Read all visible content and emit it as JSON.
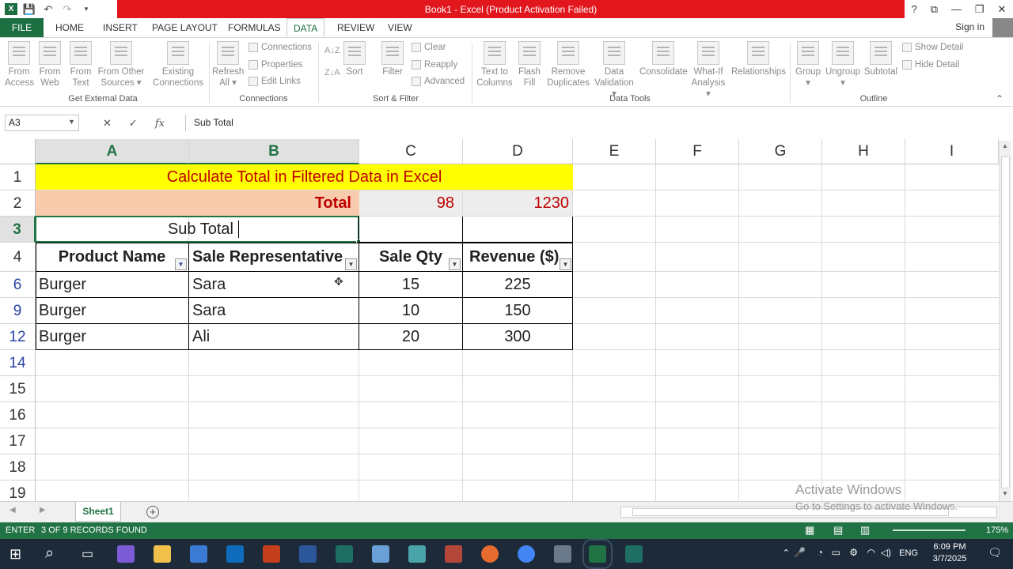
{
  "window": {
    "title": "Book1 - Excel (Product Activation Failed)",
    "buttons": [
      "?",
      "⧉",
      "—",
      "❐",
      "✕"
    ]
  },
  "tabs": [
    "FILE",
    "HOME",
    "INSERT",
    "PAGE LAYOUT",
    "FORMULAS",
    "DATA",
    "REVIEW",
    "VIEW"
  ],
  "active_tab": "DATA",
  "signin": "Sign in",
  "ribbon": {
    "get_external": {
      "buttons": [
        {
          "l1": "From",
          "l2": "Access"
        },
        {
          "l1": "From",
          "l2": "Web"
        },
        {
          "l1": "From",
          "l2": "Text"
        },
        {
          "l1": "From Other",
          "l2": "Sources ▾"
        },
        {
          "l1": "Existing",
          "l2": "Connections"
        }
      ],
      "label": "Get External Data"
    },
    "connections": {
      "refresh_l1": "Refresh",
      "refresh_l2": "All ▾",
      "small": [
        "Connections",
        "Properties",
        "Edit Links"
      ],
      "label": "Connections"
    },
    "sort_filter": {
      "sort": "Sort",
      "filter": "Filter",
      "small": [
        "Clear",
        "Reapply",
        "Advanced"
      ],
      "label": "Sort & Filter"
    },
    "data_tools": {
      "buttons": [
        {
          "l1": "Text to",
          "l2": "Columns"
        },
        {
          "l1": "Flash",
          "l2": "Fill"
        },
        {
          "l1": "Remove",
          "l2": "Duplicates"
        },
        {
          "l1": "Data",
          "l2": "Validation ▾"
        },
        {
          "l1": "Consolidate",
          "l2": ""
        },
        {
          "l1": "What-If",
          "l2": "Analysis ▾"
        },
        {
          "l1": "Relationships",
          "l2": ""
        }
      ],
      "label": "Data Tools"
    },
    "outline": {
      "buttons": [
        {
          "l1": "Group",
          "l2": "▾"
        },
        {
          "l1": "Ungroup",
          "l2": "▾"
        },
        {
          "l1": "Subtotal",
          "l2": ""
        }
      ],
      "small": [
        "Show Detail",
        "Hide Detail"
      ],
      "label": "Outline"
    }
  },
  "formula_bar": {
    "name_box": "A3",
    "formula": "Sub Total"
  },
  "columns": [
    "A",
    "B",
    "C",
    "D",
    "E",
    "F",
    "G",
    "H",
    "I"
  ],
  "rows": [
    "1",
    "2",
    "3",
    "4",
    "6",
    "9",
    "12",
    "14",
    "15",
    "16",
    "17",
    "18",
    "19"
  ],
  "sheet": {
    "title": "Calculate Total in Filtered Data in Excel",
    "total_label": "Total",
    "total_qty": "98",
    "total_revenue": "1230",
    "subtotal_label": "Sub Total",
    "headers": [
      "Product Name",
      "Sale Representative",
      "Sale Qty",
      "Revenue ($)"
    ],
    "data": [
      [
        "Burger",
        "Sara",
        "15",
        "225"
      ],
      [
        "Burger",
        "Sara",
        "10",
        "150"
      ],
      [
        "Burger",
        "Ali",
        "20",
        "300"
      ]
    ]
  },
  "sheet_tab": "Sheet1",
  "status": {
    "mode": "ENTER",
    "records": "3 OF 9 RECORDS FOUND",
    "zoom": "175%"
  },
  "watermark": {
    "line1": "Activate Windows",
    "line2": "Go to Settings to activate Windows."
  },
  "taskbar": {
    "lang": "ENG",
    "time": "6:09 PM",
    "date": "3/7/2025"
  },
  "colors": {
    "excel_green": "#217346",
    "title_red": "#e2171e",
    "title_fill": "#ffff00",
    "total_fill": "#f8cbad",
    "total_grey": "#ededed",
    "red_text": "#c00000"
  }
}
